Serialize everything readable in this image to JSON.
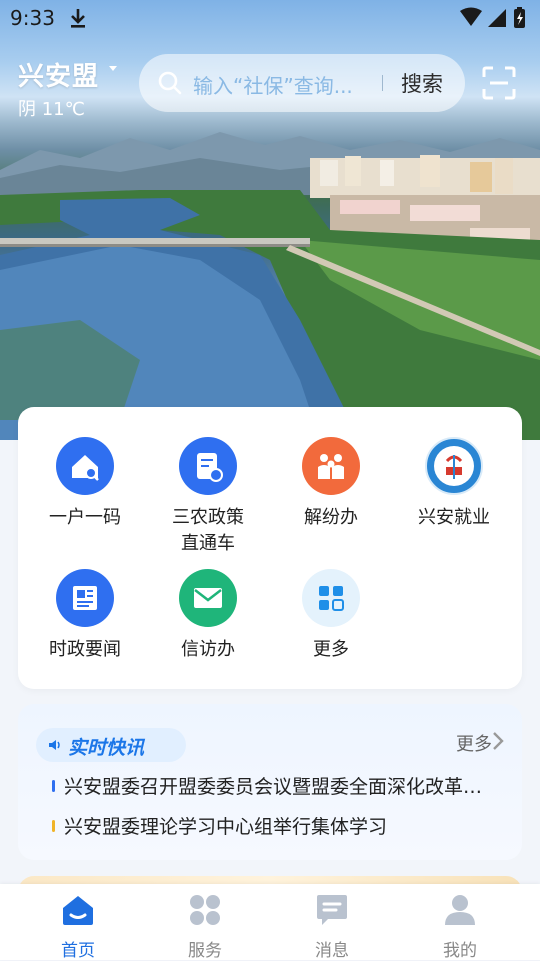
{
  "status_bar": {
    "time": "9:33"
  },
  "location": {
    "city": "兴安盟",
    "weather": "阴 11℃"
  },
  "search": {
    "placeholder": "输入“社保”查询...",
    "button": "搜索"
  },
  "services": [
    {
      "label": "一户一码",
      "icon": "house-search-icon",
      "color": "#2f6ff0"
    },
    {
      "label": "三农政策\n直通车",
      "icon": "document-pen-icon",
      "color": "#2f6ff0"
    },
    {
      "label": "解纷办",
      "icon": "people-icon",
      "color": "#f26a3c"
    },
    {
      "label": "兴安就业",
      "icon": "employment-logo-icon",
      "color": "#2a86d4"
    },
    {
      "label": "时政要闻",
      "icon": "newspaper-icon",
      "color": "#2f6ff0"
    },
    {
      "label": "信访办",
      "icon": "mail-icon",
      "color": "#1fb57a"
    },
    {
      "label": "更多",
      "icon": "grid-icon",
      "color": "#1f8fe8"
    }
  ],
  "news": {
    "title": "实时快讯",
    "more": "更多",
    "items": [
      {
        "text": "兴安盟委召开盟委委员会议暨盟委全面深化改革委员会会议",
        "bar_color": "#2f6ff0"
      },
      {
        "text": "兴安盟委理论学习中心组举行集体学习",
        "bar_color": "#f0b429"
      }
    ]
  },
  "tabs": [
    {
      "label": "首页",
      "icon": "home-icon",
      "active": true
    },
    {
      "label": "服务",
      "icon": "services-icon",
      "active": false
    },
    {
      "label": "消息",
      "icon": "message-icon",
      "active": false
    },
    {
      "label": "我的",
      "icon": "profile-icon",
      "active": false
    }
  ],
  "colors": {
    "accent": "#1f6fe0",
    "tab_inactive": "#b9c2cf"
  }
}
